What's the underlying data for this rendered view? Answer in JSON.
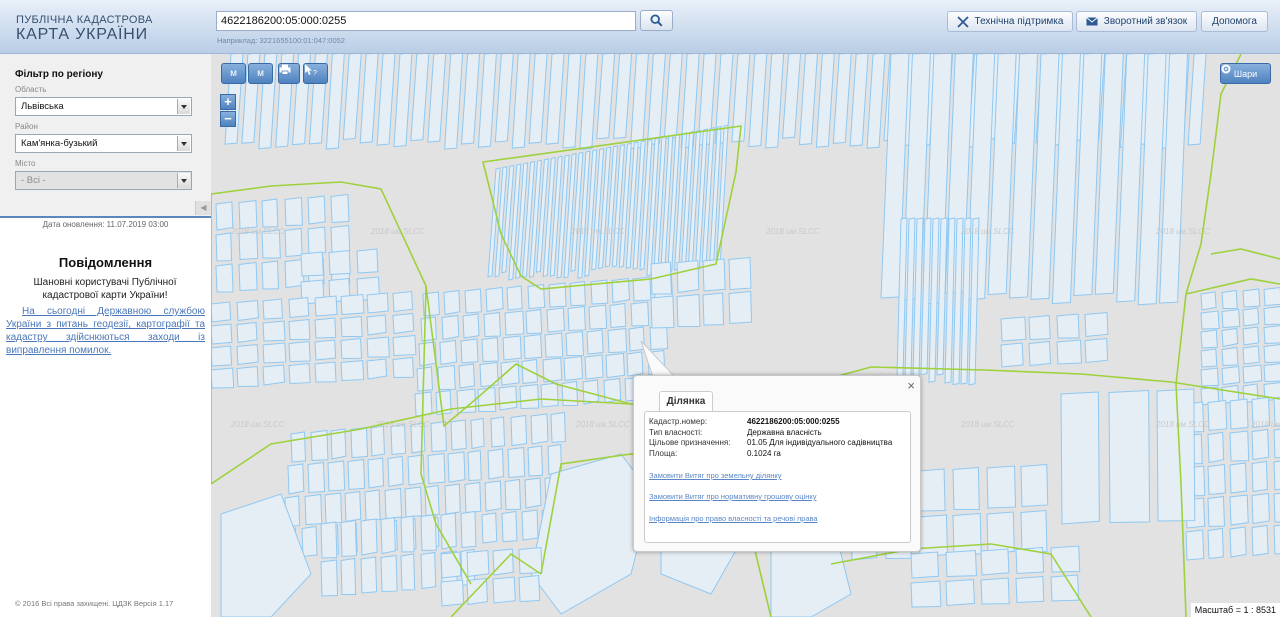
{
  "header": {
    "logo_line1": "ПУБЛІЧНА КАДАСТРОВА",
    "logo_line2": "КАРТА УКРАЇНИ",
    "search_value": "4622186200:05:000:0255",
    "search_example": "Наприклад: 3221655100:01:047:0052",
    "buttons": {
      "support": "Технічна підтримка",
      "feedback": "Зворотний зв'язок",
      "help": "Допомога"
    }
  },
  "sidebar": {
    "filter_title": "Фільтр по регіону",
    "region_label": "Область",
    "region_value": "Львівська",
    "district_label": "Район",
    "district_value": "Кам'янка-бузький",
    "city_label": "Місто",
    "city_value": "- Всі -",
    "update_date": "Дата оновлення: 11.07.2019 03:00",
    "notice_title": "Повідомлення",
    "notice_text": "Шановні користувачі Публічної кадастрової карти України!",
    "notice_link": "На сьогодні Державною службою України з питань геодезії, картографії та кадастру здійснюються заходи із виправлення помилок.",
    "copyright": "© 2016 Всі права захищені. ЦДЗК Версія 1.17"
  },
  "map": {
    "tools": [
      "м",
      "м"
    ],
    "layers_label": "Шари",
    "zoom_in": "+",
    "zoom_out": "−",
    "watermark": "2018 им.SLCC",
    "scale": "Масштаб = 1 : 8531",
    "colors": {
      "parcel": "#8fc8f2",
      "boundary": "#9ed13c",
      "background": "#e2e2e2"
    }
  },
  "popup": {
    "tab": "Ділянка",
    "close": "×",
    "rows": [
      {
        "key": "Кадастр.номер:",
        "value": "4622186200:05:000:0255"
      },
      {
        "key": "Тип власності:",
        "value": "Державна власність"
      },
      {
        "key": "Цільове призначення:",
        "value": "01.05 Для індивідуального садівництва"
      },
      {
        "key": "Площа:",
        "value": "0.1024 га"
      }
    ],
    "links": [
      "Замовити Витяг про земельну ділянку",
      "Замовити Витяг про нормативну грошову оцінку",
      "Інформація про право власності та речові права"
    ]
  }
}
